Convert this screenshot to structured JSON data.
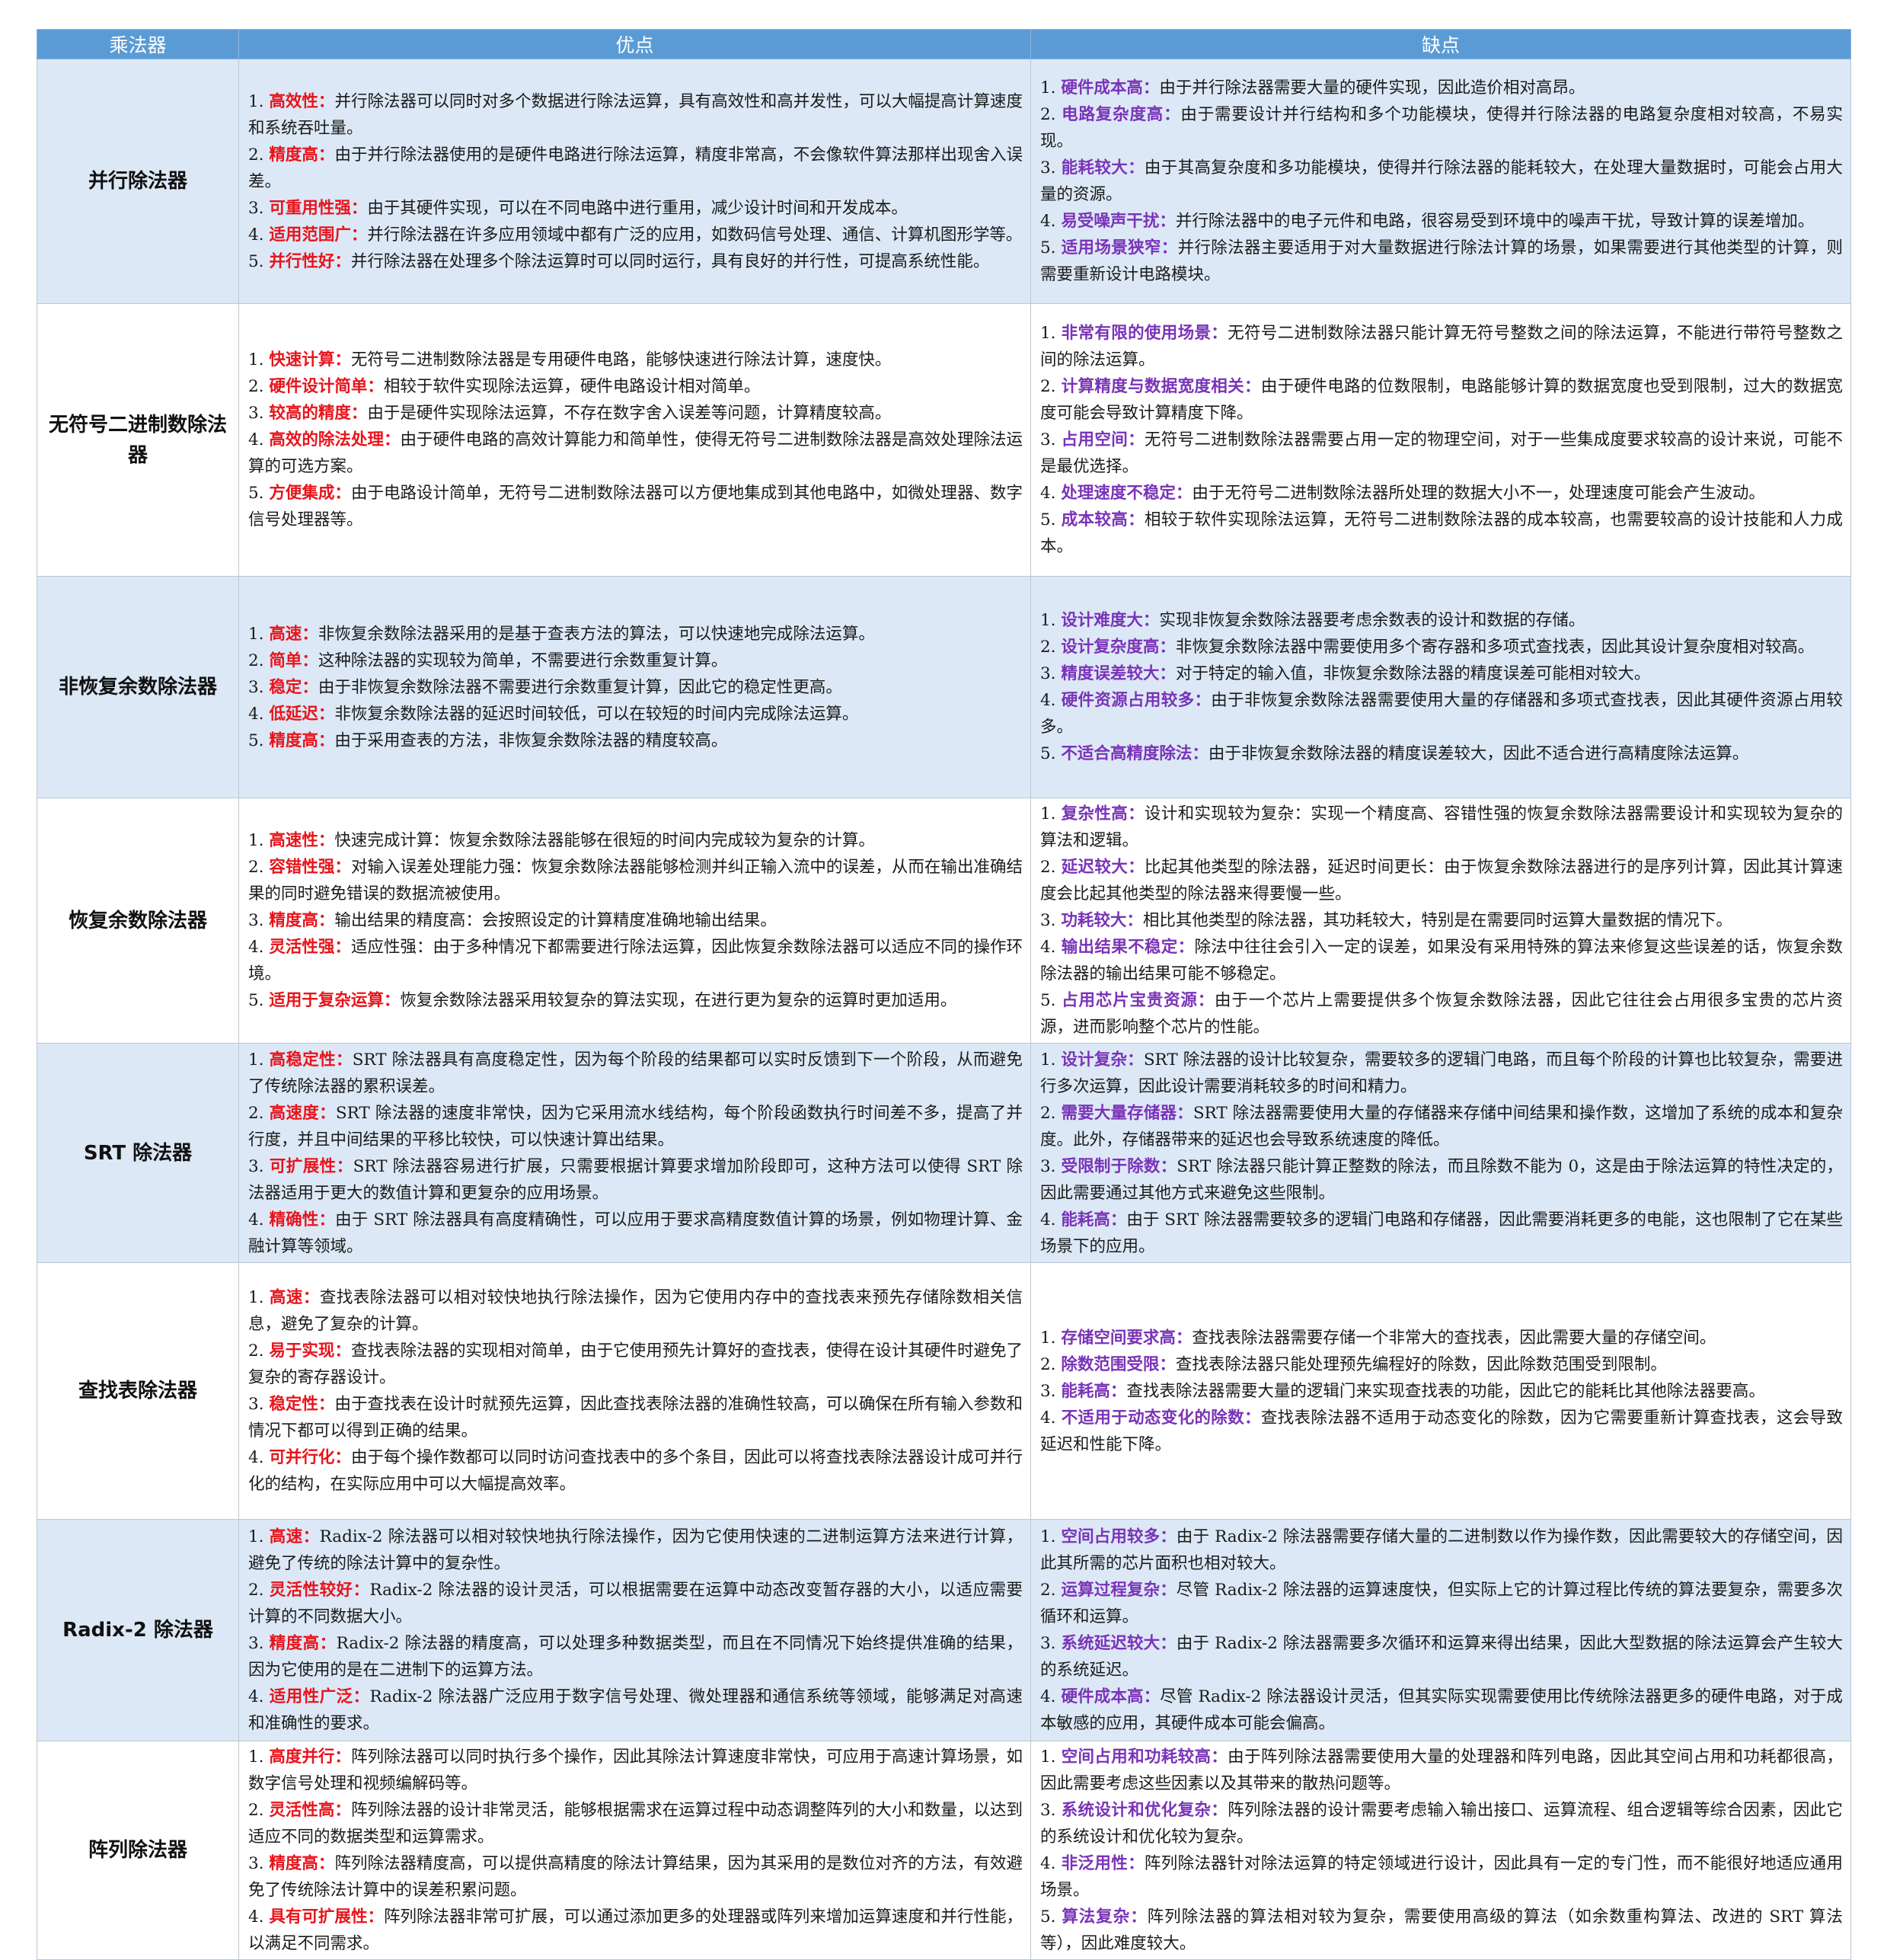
{
  "header": {
    "col1": "乘法器",
    "col2": "优点",
    "col3": "缺点"
  },
  "colors": {
    "header_bg": "#5b9bd5",
    "band_bg": "#dce8f6",
    "pro_keyword": "#e8141c",
    "con_keyword": "#7a33b8"
  },
  "rows": [
    {
      "name": "并行除法器",
      "pros": [
        {
          "num": "1. ",
          "kw": "高效性：",
          "text": "并行除法器可以同时对多个数据进行除法运算，具有高效性和高并发性，可以大幅提高计算速度和系统吞吐量。"
        },
        {
          "num": "2. ",
          "kw": "精度高：",
          "text": "由于并行除法器使用的是硬件电路进行除法运算，精度非常高，不会像软件算法那样出现舍入误差。"
        },
        {
          "num": "3. ",
          "kw": "可重用性强：",
          "text": "由于其硬件实现，可以在不同电路中进行重用，减少设计时间和开发成本。"
        },
        {
          "num": "4. ",
          "kw": "适用范围广：",
          "text": "并行除法器在许多应用领域中都有广泛的应用，如数码信号处理、通信、计算机图形学等。"
        },
        {
          "num": "5. ",
          "kw": "并行性好：",
          "text": "并行除法器在处理多个除法运算时可以同时运行，具有良好的并行性，可提高系统性能。"
        }
      ],
      "cons": [
        {
          "num": "1. ",
          "kw": "硬件成本高：",
          "text": "由于并行除法器需要大量的硬件实现，因此造价相对高昂。"
        },
        {
          "num": "2. ",
          "kw": "电路复杂度高：",
          "text": "由于需要设计并行结构和多个功能模块，使得并行除法器的电路复杂度相对较高，不易实现。"
        },
        {
          "num": "3. ",
          "kw": "能耗较大：",
          "text": "由于其高复杂度和多功能模块，使得并行除法器的能耗较大，在处理大量数据时，可能会占用大量的资源。"
        },
        {
          "num": "4. ",
          "kw": "易受噪声干扰：",
          "text": "并行除法器中的电子元件和电路，很容易受到环境中的噪声干扰，导致计算的误差增加。"
        },
        {
          "num": "5. ",
          "kw": "适用场景狭窄：",
          "text": "并行除法器主要适用于对大量数据进行除法计算的场景，如果需要进行其他类型的计算，则需要重新设计电路模块。"
        }
      ]
    },
    {
      "name": "无符号二进制数除法器",
      "pros": [
        {
          "num": "1. ",
          "kw": "快速计算：",
          "text": "无符号二进制数除法器是专用硬件电路，能够快速进行除法计算，速度快。"
        },
        {
          "num": "2. ",
          "kw": "硬件设计简单：",
          "text": "相较于软件实现除法运算，硬件电路设计相对简单。"
        },
        {
          "num": "3. ",
          "kw": "较高的精度：",
          "text": "由于是硬件实现除法运算，不存在数字舍入误差等问题，计算精度较高。"
        },
        {
          "num": "4. ",
          "kw": "高效的除法处理：",
          "text": "由于硬件电路的高效计算能力和简单性，使得无符号二进制数除法器是高效处理除法运算的可选方案。"
        },
        {
          "num": "5. ",
          "kw": "方便集成：",
          "text": "由于电路设计简单，无符号二进制数除法器可以方便地集成到其他电路中，如微处理器、数字信号处理器等。"
        }
      ],
      "cons": [
        {
          "num": "1. ",
          "kw": "非常有限的使用场景：",
          "text": "无符号二进制数除法器只能计算无符号整数之间的除法运算，不能进行带符号整数之间的除法运算。"
        },
        {
          "num": "2. ",
          "kw": "计算精度与数据宽度相关：",
          "text": "由于硬件电路的位数限制，电路能够计算的数据宽度也受到限制，过大的数据宽度可能会导致计算精度下降。"
        },
        {
          "num": "3. ",
          "kw": "占用空间：",
          "text": "无符号二进制数除法器需要占用一定的物理空间，对于一些集成度要求较高的设计来说，可能不是最优选择。"
        },
        {
          "num": "4. ",
          "kw": "处理速度不稳定：",
          "text": "由于无符号二进制数除法器所处理的数据大小不一，处理速度可能会产生波动。"
        },
        {
          "num": "5. ",
          "kw": "成本较高：",
          "text": "相较于软件实现除法运算，无符号二进制数除法器的成本较高，也需要较高的设计技能和人力成本。"
        }
      ]
    },
    {
      "name": "非恢复余数除法器",
      "pros": [
        {
          "num": "1. ",
          "kw": "高速：",
          "text": "非恢复余数除法器采用的是基于查表方法的算法，可以快速地完成除法运算。"
        },
        {
          "num": "2. ",
          "kw": "简单：",
          "text": "这种除法器的实现较为简单，不需要进行余数重复计算。"
        },
        {
          "num": "3. ",
          "kw": "稳定：",
          "text": "由于非恢复余数除法器不需要进行余数重复计算，因此它的稳定性更高。"
        },
        {
          "num": "4. ",
          "kw": "低延迟：",
          "text": "非恢复余数除法器的延迟时间较低，可以在较短的时间内完成除法运算。"
        },
        {
          "num": "5. ",
          "kw": "精度高：",
          "text": "由于采用查表的方法，非恢复余数除法器的精度较高。"
        }
      ],
      "cons": [
        {
          "num": "1. ",
          "kw": "设计难度大：",
          "text": "实现非恢复余数除法器要考虑余数表的设计和数据的存储。"
        },
        {
          "num": "2. ",
          "kw": "设计复杂度高：",
          "text": "非恢复余数除法器中需要使用多个寄存器和多项式查找表，因此其设计复杂度相对较高。"
        },
        {
          "num": "3. ",
          "kw": "精度误差较大：",
          "text": "对于特定的输入值，非恢复余数除法器的精度误差可能相对较大。"
        },
        {
          "num": "4. ",
          "kw": "硬件资源占用较多：",
          "text": "由于非恢复余数除法器需要使用大量的存储器和多项式查找表，因此其硬件资源占用较多。"
        },
        {
          "num": "5. ",
          "kw": "不适合高精度除法：",
          "text": "由于非恢复余数除法器的精度误差较大，因此不适合进行高精度除法运算。"
        }
      ]
    },
    {
      "name": "恢复余数除法器",
      "pros": [
        {
          "num": "1. ",
          "kw": "高速性：",
          "text": "快速完成计算：恢复余数除法器能够在很短的时间内完成较为复杂的计算。"
        },
        {
          "num": "2. ",
          "kw": "容错性强：",
          "text": "对输入误差处理能力强：恢复余数除法器能够检测并纠正输入流中的误差，从而在输出准确结果的同时避免错误的数据流被使用。"
        },
        {
          "num": "3. ",
          "kw": "精度高：",
          "text": "输出结果的精度高：会按照设定的计算精度准确地输出结果。"
        },
        {
          "num": "4. ",
          "kw": "灵活性强：",
          "text": "适应性强：由于多种情况下都需要进行除法运算，因此恢复余数除法器可以适应不同的操作环境。"
        },
        {
          "num": "5. ",
          "kw": "适用于复杂运算：",
          "text": "恢复余数除法器采用较复杂的算法实现，在进行更为复杂的运算时更加适用。"
        }
      ],
      "cons": [
        {
          "num": "1. ",
          "kw": "复杂性高：",
          "text": "设计和实现较为复杂：实现一个精度高、容错性强的恢复余数除法器需要设计和实现较为复杂的算法和逻辑。"
        },
        {
          "num": "2. ",
          "kw": "延迟较大：",
          "text": "比起其他类型的除法器，延迟时间更长：由于恢复余数除法器进行的是序列计算，因此其计算速度会比起其他类型的除法器来得要慢一些。"
        },
        {
          "num": "3. ",
          "kw": "功耗较大：",
          "text": "相比其他类型的除法器，其功耗较大，特别是在需要同时运算大量数据的情况下。"
        },
        {
          "num": "4. ",
          "kw": "输出结果不稳定：",
          "text": "除法中往往会引入一定的误差，如果没有采用特殊的算法来修复这些误差的话，恢复余数除法器的输出结果可能不够稳定。"
        },
        {
          "num": "5. ",
          "kw": "占用芯片宝贵资源：",
          "text": "由于一个芯片上需要提供多个恢复余数除法器，因此它往往会占用很多宝贵的芯片资源，进而影响整个芯片的性能。"
        }
      ]
    },
    {
      "name": "SRT 除法器",
      "pros": [
        {
          "num": "1. ",
          "kw": "高稳定性：",
          "text": "SRT 除法器具有高度稳定性，因为每个阶段的结果都可以实时反馈到下一个阶段，从而避免了传统除法器的累积误差。"
        },
        {
          "num": "2. ",
          "kw": "高速度：",
          "text": "SRT 除法器的速度非常快，因为它采用流水线结构，每个阶段函数执行时间差不多，提高了并行度，并且中间结果的平移比较快，可以快速计算出结果。"
        },
        {
          "num": "3. ",
          "kw": "可扩展性：",
          "text": "SRT 除法器容易进行扩展，只需要根据计算要求增加阶段即可，这种方法可以使得 SRT 除法器适用于更大的数值计算和更复杂的应用场景。"
        },
        {
          "num": "4. ",
          "kw": "精确性：",
          "text": "由于 SRT 除法器具有高度精确性，可以应用于要求高精度数值计算的场景，例如物理计算、金融计算等领域。"
        }
      ],
      "cons": [
        {
          "num": "1. ",
          "kw": "设计复杂：",
          "text": "SRT 除法器的设计比较复杂，需要较多的逻辑门电路，而且每个阶段的计算也比较复杂，需要进行多次运算，因此设计需要消耗较多的时间和精力。"
        },
        {
          "num": "2. ",
          "kw": "需要大量存储器：",
          "text": "SRT 除法器需要使用大量的存储器来存储中间结果和操作数，这增加了系统的成本和复杂度。此外，存储器带来的延迟也会导致系统速度的降低。"
        },
        {
          "num": "3. ",
          "kw": "受限制于除数：",
          "text": "SRT 除法器只能计算正整数的除法，而且除数不能为 0，这是由于除法运算的特性决定的，因此需要通过其他方式来避免这些限制。"
        },
        {
          "num": "4. ",
          "kw": "能耗高：",
          "text": "由于 SRT 除法器需要较多的逻辑门电路和存储器，因此需要消耗更多的电能，这也限制了它在某些场景下的应用。"
        }
      ]
    },
    {
      "name": "查找表除法器",
      "pros": [
        {
          "num": "1. ",
          "kw": "高速：",
          "text": "查找表除法器可以相对较快地执行除法操作，因为它使用内存中的查找表来预先存储除数相关信息，避免了复杂的计算。"
        },
        {
          "num": "2. ",
          "kw": "易于实现：",
          "text": "查找表除法器的实现相对简单，由于它使用预先计算好的查找表，使得在设计其硬件时避免了复杂的寄存器设计。"
        },
        {
          "num": "3. ",
          "kw": "稳定性：",
          "text": "由于查找表在设计时就预先运算，因此查找表除法器的准确性较高，可以确保在所有输入参数和情况下都可以得到正确的结果。"
        },
        {
          "num": "4. ",
          "kw": "可并行化：",
          "text": "由于每个操作数都可以同时访问查找表中的多个条目，因此可以将查找表除法器设计成可并行化的结构，在实际应用中可以大幅提高效率。"
        }
      ],
      "cons": [
        {
          "num": "1. ",
          "kw": "存储空间要求高：",
          "text": "查找表除法器需要存储一个非常大的查找表，因此需要大量的存储空间。"
        },
        {
          "num": "2. ",
          "kw": "除数范围受限：",
          "text": "查找表除法器只能处理预先编程好的除数，因此除数范围受到限制。"
        },
        {
          "num": "3. ",
          "kw": "能耗高：",
          "text": "查找表除法器需要大量的逻辑门来实现查找表的功能，因此它的能耗比其他除法器要高。"
        },
        {
          "num": "4. ",
          "kw": "不适用于动态变化的除数：",
          "text": "查找表除法器不适用于动态变化的除数，因为它需要重新计算查找表，这会导致延迟和性能下降。"
        }
      ]
    },
    {
      "name": "Radix-2 除法器",
      "pros": [
        {
          "num": "1. ",
          "kw": "高速：",
          "text": "Radix-2 除法器可以相对较快地执行除法操作，因为它使用快速的二进制运算方法来进行计算，避免了传统的除法计算中的复杂性。"
        },
        {
          "num": "2. ",
          "kw": "灵活性较好：",
          "text": "Radix-2 除法器的设计灵活，可以根据需要在运算中动态改变暂存器的大小，以适应需要计算的不同数据大小。"
        },
        {
          "num": "3. ",
          "kw": "精度高：",
          "text": "Radix-2 除法器的精度高，可以处理多种数据类型，而且在不同情况下始终提供准确的结果，因为它使用的是在二进制下的运算方法。"
        },
        {
          "num": "4. ",
          "kw": "适用性广泛：",
          "text": "Radix-2 除法器广泛应用于数字信号处理、微处理器和通信系统等领域，能够满足对高速和准确性的要求。"
        }
      ],
      "cons": [
        {
          "num": "1. ",
          "kw": "空间占用较多：",
          "text": "由于 Radix-2 除法器需要存储大量的二进制数以作为操作数，因此需要较大的存储空间，因此其所需的芯片面积也相对较大。"
        },
        {
          "num": "2. ",
          "kw": "运算过程复杂：",
          "text": "尽管 Radix-2 除法器的运算速度快，但实际上它的计算过程比传统的算法要复杂，需要多次循环和运算。"
        },
        {
          "num": "3. ",
          "kw": "系统延迟较大：",
          "text": "由于 Radix-2 除法器需要多次循环和运算来得出结果，因此大型数据的除法运算会产生较大的系统延迟。"
        },
        {
          "num": "4. ",
          "kw": "硬件成本高：",
          "text": "尽管 Radix-2 除法器设计灵活，但其实际实现需要使用比传统除法器更多的硬件电路，对于成本敏感的应用，其硬件成本可能会偏高。"
        }
      ]
    },
    {
      "name": "阵列除法器",
      "pros": [
        {
          "num": "1. ",
          "kw": "高度并行：",
          "text": "阵列除法器可以同时执行多个操作，因此其除法计算速度非常快，可应用于高速计算场景，如数字信号处理和视频编解码等。"
        },
        {
          "num": "2. ",
          "kw": "灵活性高：",
          "text": "阵列除法器的设计非常灵活，能够根据需求在运算过程中动态调整阵列的大小和数量，以达到适应不同的数据类型和运算需求。"
        },
        {
          "num": "3. ",
          "kw": "精度高：",
          "text": "阵列除法器精度高，可以提供高精度的除法计算结果，因为其采用的是数位对齐的方法，有效避免了传统除法计算中的误差积累问题。"
        },
        {
          "num": "4. ",
          "kw": "具有可扩展性：",
          "text": "阵列除法器非常可扩展，可以通过添加更多的处理器或阵列来增加运算速度和并行性能，以满足不同需求。"
        }
      ],
      "cons": [
        {
          "num": "1. ",
          "kw": "空间占用和功耗较高：",
          "text": "由于阵列除法器需要使用大量的处理器和阵列电路，因此其空间占用和功耗都很高，因此需要考虑这些因素以及其带来的散热问题等。"
        },
        {
          "num": "3. ",
          "kw": "系统设计和优化复杂：",
          "text": "阵列除法器的设计需要考虑输入输出接口、运算流程、组合逻辑等综合因素，因此它的系统设计和优化较为复杂。"
        },
        {
          "num": "4. ",
          "kw": "非泛用性：",
          "text": "阵列除法器针对除法运算的特定领域进行设计，因此具有一定的专门性，而不能很好地适应通用场景。"
        },
        {
          "num": "5. ",
          "kw": "算法复杂：",
          "text": "阵列除法器的算法相对较为复杂，需要使用高级的算法（如余数重构算法、改进的 SRT 算法等），因此难度较大。"
        }
      ]
    }
  ]
}
